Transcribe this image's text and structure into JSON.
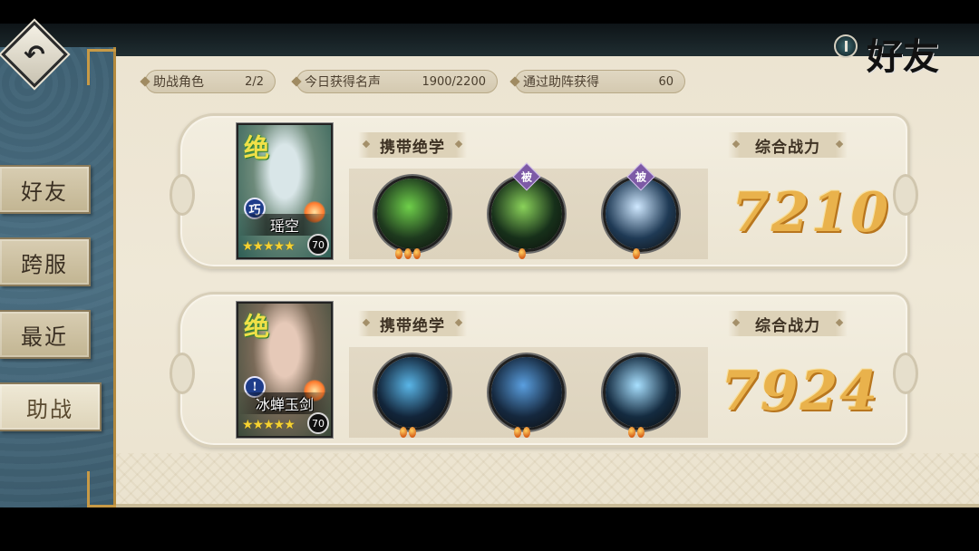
{
  "title": "好友",
  "nav": {
    "items": [
      {
        "label": "好友",
        "active": false
      },
      {
        "label": "跨服",
        "active": false
      },
      {
        "label": "最近",
        "active": false
      },
      {
        "label": "助战",
        "active": true
      }
    ]
  },
  "stats": [
    {
      "label": "助战角色",
      "value": "2/2"
    },
    {
      "label": "今日获得名声",
      "value": "1900/2200"
    },
    {
      "label": "通过助阵获得",
      "value": "60"
    }
  ],
  "cards": [
    {
      "hero_name": "瑶空",
      "rank_badge": "绝",
      "element_mark": "巧",
      "stars": "★★★★★",
      "level": "70",
      "skills_label": "携带绝学",
      "power_label": "综合战力",
      "power": "7210",
      "skills": [
        {
          "icon": "green-spirit-skill-icon",
          "tag": "",
          "gems": 3,
          "colors": [
            "#1e3a1e",
            "#6fd04a"
          ]
        },
        {
          "icon": "green-leaf-skill-icon",
          "tag": "被",
          "gems": 1,
          "colors": [
            "#17301a",
            "#8ad25a"
          ]
        },
        {
          "icon": "fist-strike-skill-icon",
          "tag": "被",
          "gems": 1,
          "colors": [
            "#1f3a55",
            "#cfe8ff"
          ]
        }
      ],
      "portrait_colors": [
        "#6d8a7a",
        "#d9e6e8",
        "#2e5e55"
      ]
    },
    {
      "hero_name": "冰蝉玉剑",
      "rank_badge": "绝",
      "element_mark": "!",
      "stars": "★★★★★",
      "level": "70",
      "skills_label": "携带绝学",
      "power_label": "综合战力",
      "power": "7924",
      "skills": [
        {
          "icon": "ice-warrior-skill-icon",
          "tag": "",
          "gems": 2,
          "colors": [
            "#12253a",
            "#5ab6e8"
          ]
        },
        {
          "icon": "ice-cicada-skill-icon",
          "tag": "",
          "gems": 2,
          "colors": [
            "#15283e",
            "#5a9fe0"
          ]
        },
        {
          "icon": "ice-sword-skill-icon",
          "tag": "",
          "gems": 2,
          "colors": [
            "#142b40",
            "#a8e0ff"
          ]
        }
      ],
      "portrait_colors": [
        "#7a6a58",
        "#e6c9b8",
        "#3a4a3a"
      ]
    }
  ]
}
